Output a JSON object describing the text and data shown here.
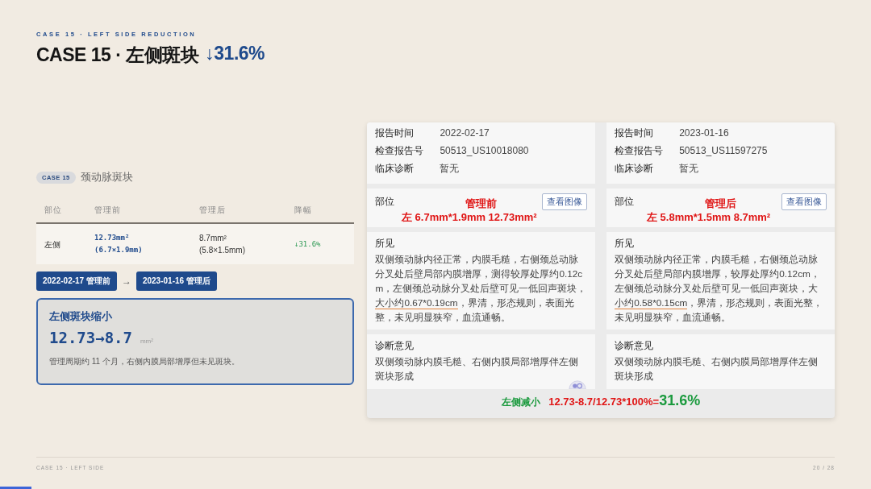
{
  "header": {
    "eyebrow": "CASE 15 · LEFT SIDE REDUCTION",
    "title": "CASE 15 · 左侧斑块",
    "change": "↓31.6%"
  },
  "case": {
    "badge": "CASE 15",
    "title": "颈动脉斑块"
  },
  "table": {
    "columns": [
      "部位",
      "管理前",
      "管理后",
      "降幅"
    ],
    "rows": [
      {
        "site": "左侧",
        "before": [
          "12.73mm²",
          "(6.7×1.9mm)"
        ],
        "after": [
          "8.7mm²",
          "(5.8×1.5mm)"
        ],
        "drop": "↓31.6%"
      }
    ]
  },
  "timeline": {
    "from": "2022-02-17 管理前",
    "arrow": "→",
    "to": "2023-01-16 管理后"
  },
  "summary": {
    "title": "左侧斑块缩小",
    "value": "12.73→8.7",
    "unit": "mm²",
    "note": "管理周期约 11 个月，右侧内膜局部增厚但未见斑块。"
  },
  "reports": [
    {
      "fields": [
        {
          "label": "报告时间",
          "value": "2022-02-17"
        },
        {
          "label": "检查报告号",
          "value": "50513_US10018080"
        },
        {
          "label": "临床诊断",
          "value": "暂无"
        }
      ],
      "site_label": "部位",
      "view_button": "查看图像",
      "note_title": "管理前",
      "note_size": "左 6.7mm*1.9mm  12.73mm²",
      "findings_label": "所见",
      "findings": {
        "before": "双侧颈动脉内径正常，内膜毛糙，右侧颈总动脉分叉处后壁局部内膜增厚，测得较厚处厚约0.12cm，左侧颈总动脉分叉处后壁可见一低回声斑块，",
        "highlight": "大小约0.67*0.19cm",
        "after": "，界清，形态规则，表面光整，未见明显狭窄，血流通畅。"
      },
      "opinion_label": "诊断意见",
      "opinion": "双侧颈动脉内膜毛糙、右侧内膜局部增厚伴左侧斑块形成"
    },
    {
      "fields": [
        {
          "label": "报告时间",
          "value": "2023-01-16"
        },
        {
          "label": "检查报告号",
          "value": "50513_US11597275"
        },
        {
          "label": "临床诊断",
          "value": "暂无"
        }
      ],
      "site_label": "部位",
      "view_button": "查看图像",
      "note_title": "管理后",
      "note_size": "左 5.8mm*1.5mm  8.7mm²",
      "findings_label": "所见",
      "findings": {
        "before": "双侧颈动脉内径正常，内膜毛糙，右侧颈总动脉分叉处后壁局部内膜增厚，较厚处厚约0.12cm，左侧颈总动脉分叉处后壁可见一低回声斑块，大",
        "highlight": "小约0.58*0.15cm",
        "after": "，界清，形态规则，表面光整，未见明显狭窄，血流通畅。"
      },
      "opinion_label": "诊断意见",
      "opinion": "双侧颈动脉内膜毛糙、右侧内膜局部增厚伴左侧斑块形成"
    }
  ],
  "formula": {
    "label": "左侧减小",
    "expr": "12.73-8.7/12.73*100%=",
    "result": "31.6%"
  },
  "footer": {
    "left": "CASE 15 · LEFT SIDE",
    "right": "20 / 28"
  },
  "progress": {
    "level": 0.036
  }
}
